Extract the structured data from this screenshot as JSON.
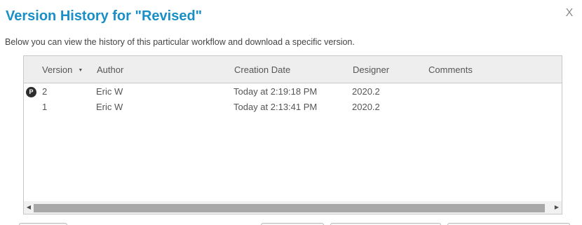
{
  "dialog": {
    "title": "Version History for \"Revised\"",
    "close_label": "X",
    "description": "Below you can view the history of this particular workflow and download a specific version."
  },
  "table": {
    "columns": {
      "version": "Version",
      "author": "Author",
      "creation_date": "Creation Date",
      "designer": "Designer",
      "comments": "Comments"
    },
    "sort_indicator": "▼",
    "rows": [
      {
        "badge": "P",
        "version": "2",
        "author": "Eric W",
        "creation_date": "Today at 2:19:18 PM",
        "designer": "2020.2",
        "comments": ""
      },
      {
        "badge": "",
        "version": "1",
        "author": "Eric W",
        "creation_date": "Today at 2:13:41 PM",
        "designer": "2020.2",
        "comments": ""
      }
    ]
  },
  "scrollbar": {
    "left_arrow": "◀",
    "right_arrow": "▶"
  },
  "icons": {
    "close": "close-icon",
    "badge": "published-badge-icon",
    "sort": "sort-descending-icon"
  },
  "colors": {
    "title": "#1a8fc6",
    "header_bg": "#eeeeee",
    "badge_bg": "#2d2d2d",
    "scroll_thumb": "#a8a8a8"
  }
}
